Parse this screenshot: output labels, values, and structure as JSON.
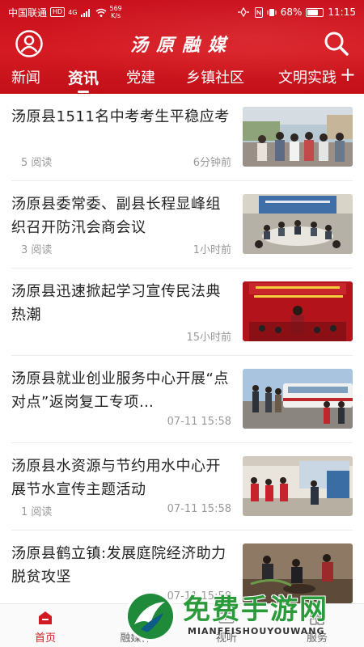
{
  "status_bar": {
    "carrier": "中国联通",
    "hd": "HD",
    "network": "4G",
    "speed_value": "569",
    "speed_unit": "K/s",
    "battery_percent": "68%",
    "battery_level": 0.68,
    "time": "11:15"
  },
  "header": {
    "title": "汤原融媒",
    "avatar_icon": "user-circle-icon",
    "search_icon": "search-icon"
  },
  "tabs": [
    {
      "label": "新闻",
      "active": false
    },
    {
      "label": "资讯",
      "active": true
    },
    {
      "label": "党建",
      "active": false
    },
    {
      "label": "乡镇社区",
      "active": false
    },
    {
      "label": "文明实践",
      "active": false
    }
  ],
  "add_tab_label": "+",
  "news": [
    {
      "title": "汤原县1511名中考考生平稳应考",
      "reads": "5 阅读",
      "time": "6分钟前",
      "thumb": "exam-students-photo"
    },
    {
      "title": "汤原县委常委、副县长程显峰组织召开防汛会商会议",
      "reads": "3 阅读",
      "time": "1小时前",
      "thumb": "meeting-photo"
    },
    {
      "title": "汤原县迅速掀起学习宣传民法典热潮",
      "reads": "",
      "time": "15小时前",
      "thumb": "civil-code-event-photo"
    },
    {
      "title": "汤原县就业创业服务中心开展“点对点”返岗复工专项…",
      "reads": "",
      "time": "07-11 15:58",
      "thumb": "bus-departure-photo"
    },
    {
      "title": "汤原县水资源与节约用水中心开展节水宣传主题活动",
      "reads": "1 阅读",
      "time": "07-11 15:58",
      "thumb": "water-saving-event-photo"
    },
    {
      "title": "汤原县鹤立镇:发展庭院经济助力脱贫攻坚",
      "reads": "",
      "time": "07-11 15:58",
      "thumb": "farming-photo"
    }
  ],
  "bottom_nav": [
    {
      "label": "首页",
      "icon": "home-icon",
      "active": true
    },
    {
      "label": "融媒体",
      "icon": "media-icon",
      "active": false
    },
    {
      "label": "视听",
      "icon": "video-icon",
      "active": false
    },
    {
      "label": "服务",
      "icon": "service-icon",
      "active": false
    }
  ],
  "watermark": {
    "text": "免费手游网",
    "subtext": "MIANFEISHOUYOUWANG"
  },
  "colors": {
    "brand_red": "#d11a24",
    "watermark_green": "#2a9a3a"
  }
}
